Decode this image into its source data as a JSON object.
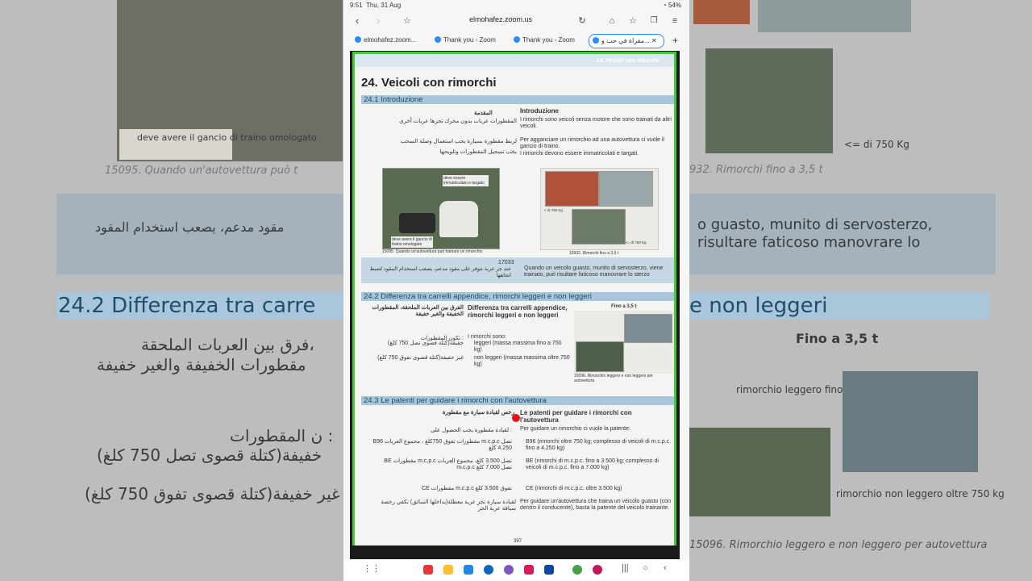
{
  "status_bar": {
    "time": "9:51",
    "date": "Thu, 31 Aug",
    "battery": "54%"
  },
  "browser": {
    "url": "elmohafez.zoom.us",
    "tabs": [
      {
        "label": "elmohafez.zoom..."
      },
      {
        "label": "Thank you - Zoom"
      },
      {
        "label": "Thank you - Zoom"
      },
      {
        "label": "مقراة في حب و..."
      }
    ]
  },
  "page": {
    "header_right": "24. Veicoli con rimorchi",
    "title": "24. Veicoli con rimorchi",
    "sec1": "24.1 Introduzione",
    "sec1_it_title": "Introduzione",
    "sec1_ar_title": "المقدمة",
    "sec1_it_1": "I rimorchi sono veicoli senza motore che sono trainati da altri veicoli.",
    "sec1_ar_1": "المقطورات عربات بدون محرك تجرها عربات أخرى",
    "sec1_it_2": "Per agganciare un rimorchio ad una autovettura ci vuole il gancio di traino.",
    "sec1_ar_2": "لربط مقطورة بسيارة يجب استعمال وصلة السحب",
    "sec1_it_3": "I rimorchi devono essere immatricolati e targati.",
    "sec1_ar_3": "يجب تسجيل المقطورات وتلويحها",
    "photo1_label": "deve essere immatricolato e targato",
    "photo1_label2": "deve avere il gancio di traino omologato",
    "caption1": "15095. Quando un'autovettura può trainare un rimorchio",
    "caption2": "16932. Rimorchi fino a 3,5 t",
    "label_750": "< di 750 Kg",
    "label_750b": "<= di 750 Kg",
    "q_code": "17033",
    "q_it": "Quando un veicolo guasto, munito di servosterzo, viene trainato, può risultare faticoso manovrare lo sterzo",
    "q_ar": "عند جر عربة تتوفر على مقود مدعم، يصعب استخدام المقود لضبط اتجاهها",
    "sec2": "24.2 Differenza tra carrelli appendice, rimorchi leggeri e non leggeri",
    "sec2_it_title": "Differenza tra carrelli appendice, rimorchi leggeri e non leggeri",
    "sec2_ar_title": "الفرق بين العربات الملحقة، المقطورات الخفيفة والغير خفيفة",
    "sec2_it_1": "I rimorchi sono:",
    "sec2_ar_1": "تكون المقطورات :",
    "sec2_it_2": "leggeri (massa massima fino a 750 kg)",
    "sec2_ar_2": "خفيفة(كتلة قصوى تصل 750 كلغ)",
    "sec2_it_3": "non leggeri (massa massima oltre 750 kg)",
    "sec2_ar_3": "غير خفيفة(كتلة قصوى تفوق 750 كلغ)",
    "fino_35": "Fino a 3,5 t",
    "caption3": "15096. Rimorchio leggero e non leggero per autovettura",
    "sec3": "24.3 Le patenti per guidare i rimorchi con l'autovettura",
    "sec3_it_title": "Le patenti per guidare i rimorchi con l'autovettura",
    "sec3_ar_title": "رخص لقيادة سيارة مع مقطورة",
    "sec3_it_1": "Per guidare un rimorchio ci vuole la patente:",
    "sec3_ar_1": "لقيادة مقطورة يجب الحصول على :",
    "sec3_it_2": "B96 (rimorchi oltre 750 kg; complesso di veicoli di m.c.p.c. fino a 4.250 kg)",
    "sec3_ar_2": "B96 مقطورات تفوق 750كلغ ، مجموع العربات m.c.p.c تصل 4.250 كلغ",
    "sec3_it_3": "BE (rimorchi di m.c.p.c. fino a 3.500 kg; complesso di veicoli di m.c.p.c. fino a 7.000 kg)",
    "sec3_ar_3": "BE مقطورات m.c.p.c تصل 3.500 كلغ، مجموع العربات m.c.p.c تصل 7.000 كلغ",
    "sec3_it_4": "CE (rimorchi di m.c.p.c. oltre 3.500 kg)",
    "sec3_ar_4": "CE مقطورات m.c.p.c تفوق 3.500 كلغ",
    "sec3_it_5": "Per guidare un'autovettura che traina un veicolo guasto (con dentro il conducente), basta la patente del veicolo trainante.",
    "sec3_ar_5": "لقيادة سيارة تجر عربة معطلة(بداخلها السائق) تكفي رخصة سياقة عربة الجر",
    "page_number": "397"
  },
  "background": {
    "left_caption": "deve avere il gancio di traino omologato",
    "left_small": "15095. Quando un'autovettura può t",
    "left_arabic": "مقود مدعم، يصعب استخدام المقود",
    "left_sec2": "24.2 Differenza tra carre",
    "left_ar2a": "فرق بين العربات الملحقة،",
    "left_ar2b": "مقطورات الخفيفة والغير خفيفة",
    "left_ar3": "ن المقطورات :",
    "left_ar4": "خفيفة(كتلة قصوى تصل 750 كلغ)",
    "left_ar5": "غير خفيفة(كتلة قصوى تفوق 750 كلغ)",
    "right_small": "932. Rimorchi fino a 3,5 t",
    "right_kg": "<= di 750 Kg",
    "right_it1": "o guasto, munito di servosterzo,",
    "right_it2": "risultare faticoso manovrare lo",
    "right_sec2": "e non leggeri",
    "right_fino": "Fino a 3,5 t",
    "right_rim1": "rimorchio leggero fino a 750 kg",
    "right_rim2": "rimorchio non leggero oltre 750 kg",
    "right_cap": "15096. Rimorchio leggero e non leggero per autovettura"
  },
  "colors": {
    "accent": "#2d8cff",
    "frame": "#45c83a",
    "section": "#a8c6db"
  }
}
